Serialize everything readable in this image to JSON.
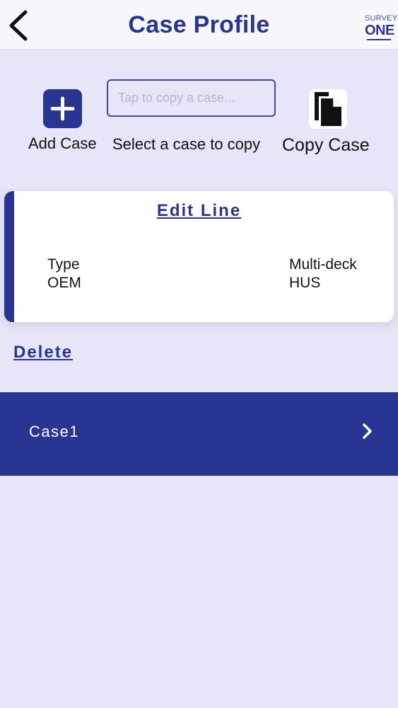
{
  "header": {
    "title": "Case Profile",
    "logo_top": "SURVEY",
    "logo_main": "ONE"
  },
  "toolbar": {
    "add_label": "Add Case",
    "copy_input_placeholder": "Tap to copy a case...",
    "copy_input_value": "",
    "select_label": "Select a case to copy",
    "copy_label": "Copy Case"
  },
  "card": {
    "edit_label": "Edit Line",
    "type_label": "Type",
    "type_value": "OEM",
    "multideck_label": "Multi-deck",
    "multideck_value": "HUS"
  },
  "delete_label": "Delete",
  "cases": [
    {
      "label": "Case1"
    }
  ],
  "icons": {
    "back": "chevron-left-icon",
    "add": "plus-icon",
    "copy": "copy-document-icon",
    "row_chevron": "chevron-right-icon"
  },
  "colors": {
    "brand": "#283593",
    "background": "#e6e6f8",
    "header_bg": "#f6f6fb",
    "card_bg": "#ffffff"
  }
}
